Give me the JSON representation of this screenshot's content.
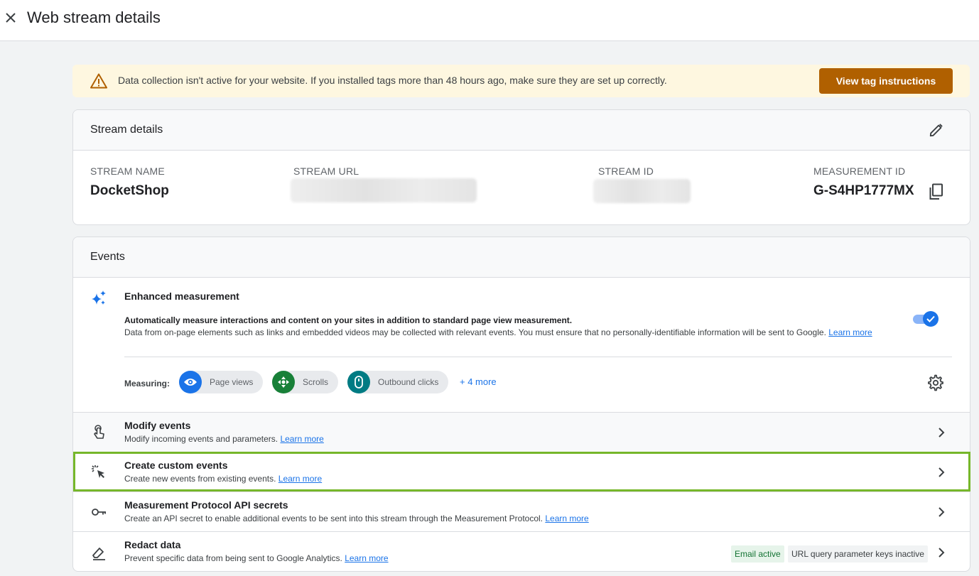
{
  "header": {
    "title": "Web stream details",
    "close_icon": "close-icon"
  },
  "banner": {
    "message": "Data collection isn't active for your website. If you installed tags more than 48 hours ago, make sure they are set up correctly.",
    "button_label": "View tag instructions",
    "icon": "warning-icon",
    "colors": {
      "background": "#fef7e0",
      "button": "#b06000"
    }
  },
  "stream_details": {
    "title": "Stream details",
    "edit_icon": "pencil-icon",
    "fields": {
      "stream_name": {
        "label": "STREAM NAME",
        "value": "DocketShop"
      },
      "stream_url": {
        "label": "STREAM URL"
      },
      "stream_id": {
        "label": "STREAM ID"
      },
      "measurement_id": {
        "label": "MEASUREMENT ID",
        "value": "G-S4HP1777MX"
      }
    },
    "copy_icon": "copy-icon"
  },
  "events": {
    "title": "Events",
    "enhanced": {
      "icon": "sparkle-icon",
      "title": "Enhanced measurement",
      "subtitle": "Automatically measure interactions and content on your sites in addition to standard page view measurement.",
      "description": "Data from on-page elements such as links and embedded videos may be collected with relevant events. You must ensure that no personally-identifiable information will be sent to Google.",
      "learn_more": "Learn more",
      "toggle_on": true,
      "measuring_label": "Measuring:",
      "chips": [
        {
          "label": "Page views",
          "icon": "eye-icon",
          "color": "#1a73e8"
        },
        {
          "label": "Scrolls",
          "icon": "scroll-arrows-icon",
          "color": "#188038"
        },
        {
          "label": "Outbound clicks",
          "icon": "mouse-icon",
          "color": "#007b83"
        }
      ],
      "more_link": "+ 4 more",
      "settings_icon": "gear-icon"
    },
    "rows": [
      {
        "icon": "touch-hand-icon",
        "title": "Modify events",
        "subtitle": "Modify incoming events and parameters.",
        "link": "Learn more"
      },
      {
        "icon": "cursor-click-icon",
        "title": "Create custom events",
        "subtitle": "Create new events from existing events.",
        "link": "Learn more"
      },
      {
        "icon": "key-icon",
        "title": "Measurement Protocol API secrets",
        "subtitle": "Create an API secret to enable additional events to be sent into this stream through the Measurement Protocol.",
        "link": "Learn more"
      },
      {
        "icon": "eraser-icon",
        "title": "Redact data",
        "subtitle": "Prevent specific data from being sent to Google Analytics.",
        "link": "Learn more",
        "badges": [
          "Email active",
          "URL query parameter keys inactive"
        ]
      }
    ],
    "highlight_color": "#76b72a"
  }
}
